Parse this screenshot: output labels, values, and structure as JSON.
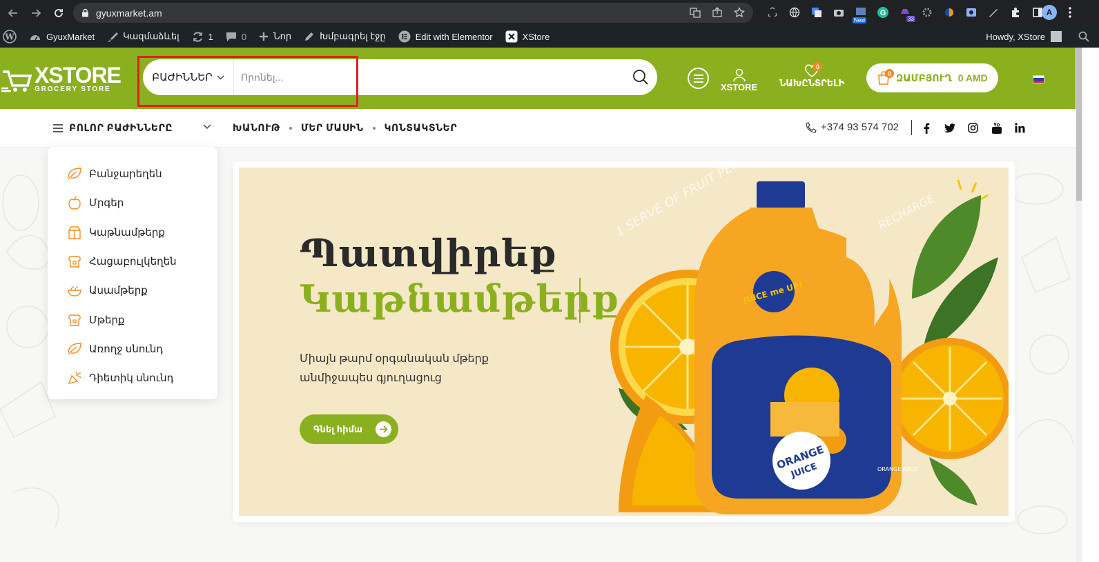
{
  "browser": {
    "url": "gyuxmarket.am",
    "avatar_letter": "A",
    "ext_badge_count": "33",
    "ext_badge_new": "New"
  },
  "wp_admin": {
    "site_name": "GyuxMarket",
    "customize": "Կազմաձևել",
    "updates_count": "1",
    "comments_count": "0",
    "new": "Նոր",
    "edit_page": "Խմբագրել էջը",
    "elementor": "Edit with Elementor",
    "xstore": "XStore",
    "howdy": "Howdy, XStore"
  },
  "header": {
    "logo_main": "XSTORE",
    "logo_sub": "GROCERY STORE",
    "search_category": "ԲԱԺԻՆՆԵՐ",
    "search_placeholder": "Որոնել...",
    "account_label": "XSTORE",
    "wishlist_label": "ՆԱԽԸՆՏՐԵԼԻ",
    "wishlist_count": "0",
    "cart_label": "ԶԱՄԲՅՈՒՂ",
    "cart_amount": "0 AMD",
    "cart_count": "0",
    "accent_color": "#8bb01f",
    "badge_color": "#f58a1f"
  },
  "nav": {
    "all_categories": "ԲՈԼՈՐ ԲԱԺԻՆՆԵՐԸ",
    "menu": [
      "ԽԱՆՈՒԹ",
      "ՄԵՐ ՄԱՍԻՆ",
      "ԿՈՆՏԱԿՏՆԵՐ"
    ],
    "phone": "+374 93 574 702",
    "socials": [
      "facebook-icon",
      "twitter-icon",
      "instagram-icon",
      "youtube-icon",
      "linkedin-icon"
    ]
  },
  "categories": [
    {
      "label": "Բանջարեղեն",
      "icon": "leaf-icon"
    },
    {
      "label": "Մրգեր",
      "icon": "apple-icon"
    },
    {
      "label": "Կաթնամթերք",
      "icon": "milk-carton-icon"
    },
    {
      "label": "Հացաբուլկեղեն",
      "icon": "bread-icon"
    },
    {
      "label": "Ասամթերք",
      "icon": "bowl-icon"
    },
    {
      "label": "Մթերք",
      "icon": "bread-icon"
    },
    {
      "label": "Առողջ սնունդ",
      "icon": "leaf-icon"
    },
    {
      "label": "Դիետիկ սնունդ",
      "icon": "carrot-icon"
    }
  ],
  "hero": {
    "title_line1": "Պատվիրեք",
    "title_line2": "Կաթնամթերք",
    "description": "Միայն թարմ օրգանական մթերք անմիջապես գյուղացուց",
    "cta": "Գնել հիմա",
    "banner_color": "#f5e8c6",
    "product_art": {
      "brand": "JUICE me UP!",
      "product": "ORANGE JUICE",
      "tagline": "1 SERVE OF FRUIT PER 125ML",
      "recharge": "RECHARGE"
    }
  }
}
